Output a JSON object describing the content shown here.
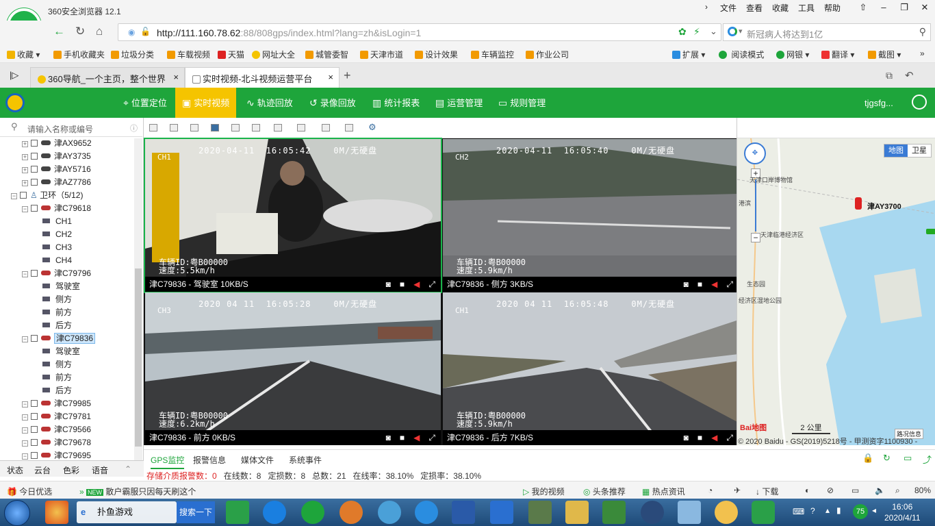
{
  "browser": {
    "app_title": "360安全浏览器 12.1",
    "menu": [
      "文件",
      "查看",
      "收藏",
      "工具",
      "帮助"
    ],
    "url_host": "http://111.160.78.62",
    "url_rest": ":88/808gps/index.html?lang=zh&isLogin=1",
    "search_placeholder": "新冠病人将达到1亿",
    "bookmarks": [
      "收藏",
      "手机收藏夹",
      "垃圾分类",
      "车载视频",
      "天猫",
      "网址大全",
      "城管委智",
      "天津市道",
      "设计效果",
      "车辆监控",
      "作业公司"
    ],
    "bookmark_right": [
      "扩展",
      "阅读模式",
      "网银",
      "翻译",
      "截图"
    ],
    "tabs": [
      "360导航_一个主页，整个世界",
      "实时视频-北斗视频运营平台"
    ]
  },
  "app": {
    "nav": [
      "位置定位",
      "实时视频",
      "轨迹回放",
      "录像回放",
      "统计报表",
      "运营管理",
      "规则管理"
    ],
    "user": "tjgsfg...",
    "search_placeholder": "请输入名称或编号"
  },
  "tree": {
    "top_vehicles": [
      "津AX9652",
      "津AY3735",
      "津AY5716",
      "津AZ7786"
    ],
    "group": "卫环（5/12)",
    "v1": "津C79618",
    "v1_channels": [
      "CH1",
      "CH2",
      "CH3",
      "CH4"
    ],
    "v2": "津C79796",
    "v2_channels": [
      "驾驶室",
      "侧方",
      "前方",
      "后方"
    ],
    "v3": "津C79836",
    "v3_channels": [
      "驾驶室",
      "侧方",
      "前方",
      "后方"
    ],
    "bottom_vehicles": [
      "津C79985",
      "津C79781",
      "津C79566",
      "津C79678",
      "津C79695"
    ],
    "bottom_tabs": [
      "状态",
      "云台",
      "色彩",
      "语音"
    ]
  },
  "videos": [
    {
      "timestamp": "2020-04-11  16:05:42",
      "disk": "0M/无硬盘",
      "channel": "CH1",
      "overlay": "车辆ID:粤B00000\n速度:5.5km/h",
      "label": "津C79836 - 驾驶室 10KB/S"
    },
    {
      "timestamp": "2020-04-11  16:05:40",
      "disk": "0M/无硬盘",
      "channel": "CH2",
      "overlay": "车辆ID:粤B00000\n速度:5.9km/h",
      "label": "津C79836 - 侧方 3KB/S"
    },
    {
      "timestamp": "2020 04 11  16:05:28",
      "disk": "0M/无硬盘",
      "channel": "CH3",
      "overlay": "车辆ID:粤B00000\n速度:6.2km/h",
      "label": "津C79836 - 前方 0KB/S"
    },
    {
      "timestamp": "2020 04 11  16:05:48",
      "disk": "0M/无硬盘",
      "channel": "CH1",
      "overlay": "车辆ID:粤B00000\n速度:5.9km/h",
      "label": "津C79836 - 后方 7KB/S"
    }
  ],
  "map": {
    "modes": [
      "地图",
      "卫星"
    ],
    "places": [
      "天津口岸博物馆",
      "港滨",
      "天津临港经济区",
      "生态园",
      "经济区湿地公园"
    ],
    "vehicle": "津AY3700",
    "scale": "2 公里",
    "traffic": "路况信息",
    "copyright": "© 2020 Baidu - GS(2019)5218号 - 甲测资字1100930 -"
  },
  "bottom": {
    "tabs": [
      "GPS监控",
      "报警信息",
      "媒体文件",
      "系统事件"
    ],
    "stats": {
      "alarm_label": "存储介质报警数：",
      "alarm": "0",
      "online_label": "在线数：",
      "online": "8",
      "located_label": "定损数：",
      "located": "8",
      "total_label": "总数：",
      "total": "21",
      "online_rate_label": "在线率：",
      "online_rate": "38.10%",
      "loc_rate_label": "定损率：",
      "loc_rate": "38.10%"
    }
  },
  "status_bar": {
    "left": "今日优选",
    "news_badge": "NEW",
    "news": "散户霸服只因每天刷这个",
    "right": [
      "我的视频",
      "头条推荐",
      "热点资讯",
      "下载"
    ],
    "zoom": "80%"
  },
  "taskbar": {
    "game": "扑鱼游戏",
    "search": "搜索一下",
    "tray_badge": "75",
    "time": "16:06",
    "date": "2020/4/11"
  }
}
